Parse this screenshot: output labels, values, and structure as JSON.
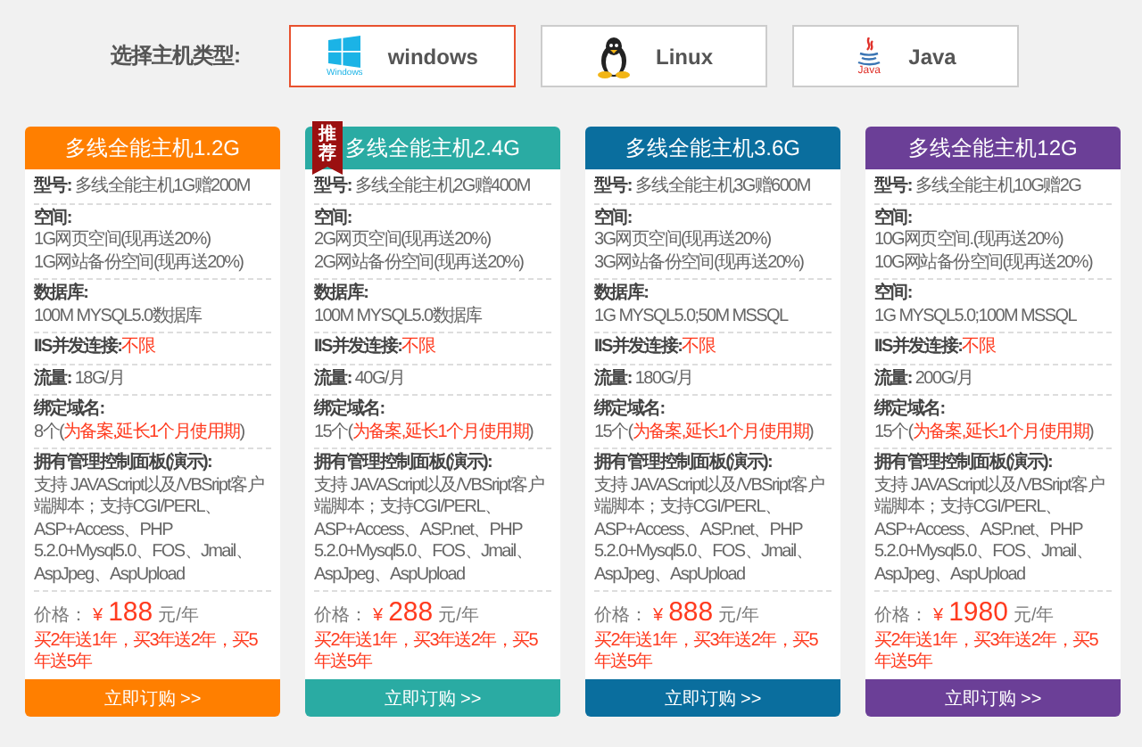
{
  "os_selector": {
    "label": "选择主机类型:",
    "options": [
      {
        "kind": "windows",
        "label": "windows",
        "caption": "Windows",
        "selected": true
      },
      {
        "kind": "linux",
        "label": "Linux",
        "selected": false
      },
      {
        "kind": "java",
        "label": "Java",
        "caption": "Java",
        "selected": false
      }
    ]
  },
  "plans": [
    {
      "title": "多线全能主机1.2G",
      "color": "#ff7f00",
      "model_label": "型号:",
      "model": "多线全能主机1G赠200M",
      "space_label": "空间:",
      "space_lines": [
        "1G网页空间(现再送20%)",
        "1G网站备份空间(现再送20%)"
      ],
      "db_label": "数据库:",
      "db": "100M MYSQL5.0数据库",
      "iis_label": "IIS并发连接:",
      "iis": "不限",
      "traffic_label": "流量:",
      "traffic": "18G/月",
      "domain_label": "绑定域名:",
      "domain_count": "8个(",
      "domain_note": "为备案,延长1个月使用期",
      "domain_close": ")",
      "panel_label": "拥有管理控制面板(演示):",
      "panel_text": "支持 JAVAScript以及/VBSript客户端脚本；支持CGI/PERL、ASP+Access、PHP 5.2.0+Mysql5.0、FOS、Jmail、AspJpeg、AspUpload",
      "price_label": "价格：",
      "currency": "¥",
      "price": "188",
      "unit": "元/年",
      "promo": "买2年送1年，买3年送2年，买5年送5年",
      "button": "立即订购 >>"
    },
    {
      "title": "多线全能主机2.4G",
      "color": "#2aaba3",
      "badge": "推荐",
      "model_label": "型号:",
      "model": "多线全能主机2G赠400M",
      "space_label": "空间:",
      "space_lines": [
        "2G网页空间(现再送20%)",
        "2G网站备份空间(现再送20%)"
      ],
      "db_label": "数据库:",
      "db": "100M MYSQL5.0数据库",
      "iis_label": "IIS并发连接:",
      "iis": "不限",
      "traffic_label": "流量:",
      "traffic": "40G/月",
      "domain_label": "绑定域名:",
      "domain_count": "15个(",
      "domain_note": "为备案,延长1个月使用期",
      "domain_close": ")",
      "panel_label": "拥有管理控制面板(演示):",
      "panel_text": "支持 JAVAScript以及/VBSript客户端脚本；支持CGI/PERL、ASP+Access、ASP.net、PHP 5.2.0+Mysql5.0、FOS、Jmail、AspJpeg、AspUpload",
      "price_label": "价格：",
      "currency": "¥",
      "price": "288",
      "unit": "元/年",
      "promo": "买2年送1年，买3年送2年，买5年送5年",
      "button": "立即订购 >>"
    },
    {
      "title": "多线全能主机3.6G",
      "color": "#0a6e9e",
      "model_label": "型号:",
      "model": "多线全能主机3G赠600M",
      "space_label": "空间:",
      "space_lines": [
        "3G网页空间(现再送20%)",
        "3G网站备份空间(现再送20%)"
      ],
      "db_label": "数据库:",
      "db": "1G MYSQL5.0;50M MSSQL",
      "iis_label": "IIS并发连接:",
      "iis": "不限",
      "traffic_label": "流量:",
      "traffic": "180G/月",
      "domain_label": "绑定域名:",
      "domain_count": "15个(",
      "domain_note": "为备案,延长1个月使用期",
      "domain_close": ")",
      "panel_label": "拥有管理控制面板(演示):",
      "panel_text": "支持 JAVAScript以及/VBSript客户端脚本；支持CGI/PERL、ASP+Access、ASP.net、PHP 5.2.0+Mysql5.0、FOS、Jmail、AspJpeg、AspUpload",
      "price_label": "价格：",
      "currency": "¥",
      "price": "888",
      "unit": "元/年",
      "promo": "买2年送1年，买3年送2年，买5年送5年",
      "button": "立即订购 >>"
    },
    {
      "title": "多线全能主机12G",
      "color": "#6b3f97",
      "model_label": "型号:",
      "model": "多线全能主机10G赠2G",
      "space_label": "空间:",
      "space_lines": [
        "10G网页空间.(现再送20%)",
        "10G网站备份空间(现再送20%)"
      ],
      "db_label": "空间:",
      "db": "1G MYSQL5.0;100M MSSQL",
      "iis_label": "IIS并发连接:",
      "iis": "不限",
      "traffic_label": "流量:",
      "traffic": "200G/月",
      "domain_label": "绑定域名:",
      "domain_count": "15个(",
      "domain_note": "为备案,延长1个月使用期",
      "domain_close": ")",
      "panel_label": "拥有管理控制面板(演示):",
      "panel_text": "支持 JAVAScript以及/VBSript客户端脚本；支持CGI/PERL、ASP+Access、ASP.net、PHP 5.2.0+Mysql5.0、FOS、Jmail、AspJpeg、AspUpload",
      "price_label": "价格：",
      "currency": "¥",
      "price": "1980",
      "unit": "元/年",
      "promo": "买2年送1年，买3年送2年，买5年送5年",
      "button": "立即订购 >>"
    }
  ]
}
